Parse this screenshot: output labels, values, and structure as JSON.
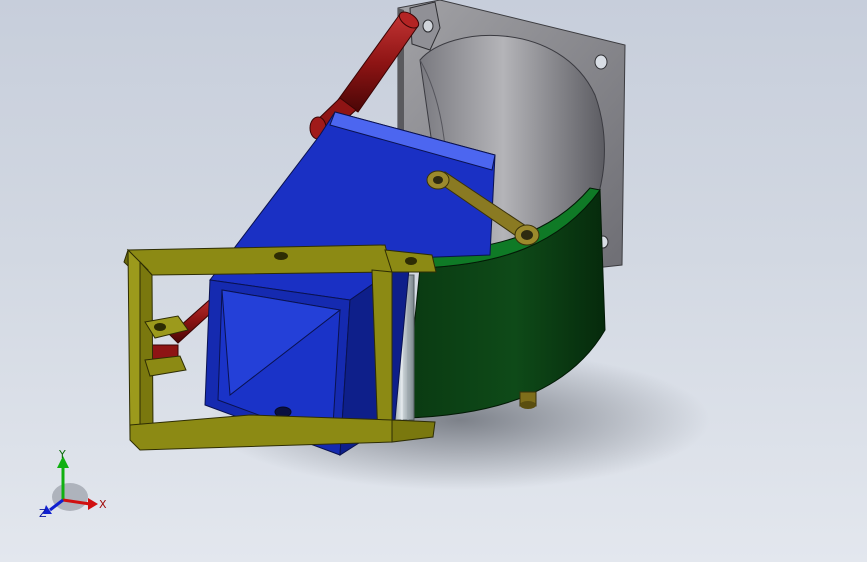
{
  "viewport": {
    "background_top": "#c7cedb",
    "background_bottom": "#e3e7ee"
  },
  "model": {
    "parts": [
      {
        "name": "mounting-plate",
        "color": "#8f8f93"
      },
      {
        "name": "cone-body",
        "color": "#9a9a9e"
      },
      {
        "name": "hydraulic-cylinder",
        "color": "#8e1414"
      },
      {
        "name": "blue-housing",
        "color": "#1a33c8"
      },
      {
        "name": "green-arc-segment",
        "color": "#0b3d14"
      },
      {
        "name": "olive-frame",
        "color": "#8c8a14"
      },
      {
        "name": "brass-link",
        "color": "#8a7a22"
      },
      {
        "name": "aluminum-roller",
        "color": "#b7c2c8"
      }
    ]
  },
  "triad": {
    "x_label": "X",
    "y_label": "Y",
    "z_label": "Z",
    "x_color": "#d01010",
    "y_color": "#10b010",
    "z_color": "#1020d0"
  }
}
